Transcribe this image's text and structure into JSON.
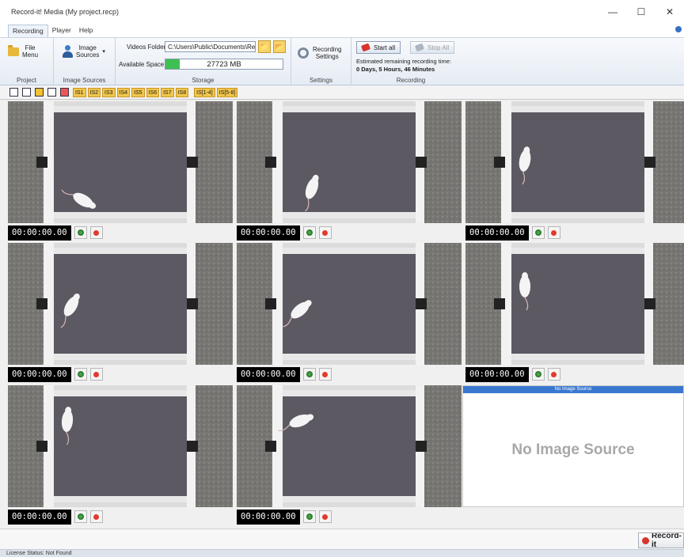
{
  "window": {
    "title": "Record-it! Media (My project.recp)",
    "controls": {
      "minimize": "—",
      "maximize": "☐",
      "close": "✕"
    }
  },
  "tabs": [
    {
      "label": "Recording",
      "active": true
    },
    {
      "label": "Player",
      "active": false
    },
    {
      "label": "Help",
      "active": false
    }
  ],
  "ribbon": {
    "project": {
      "group_label": "Project",
      "file_menu": "File\nMenu"
    },
    "image_sources": {
      "group_label": "Image Sources",
      "button": "Image\nSources"
    },
    "storage": {
      "group_label": "Storage",
      "videos_folder_label": "Videos Folder:",
      "videos_folder_value": "C:\\Users\\Public\\Documents\\Re",
      "available_space_label": "Available Space:",
      "available_space_value": "27723 MB",
      "available_space_fraction": 0.12
    },
    "settings": {
      "group_label": "Settings",
      "button": "Recording\nSettings"
    },
    "recording": {
      "group_label": "Recording",
      "start_all": "Start all",
      "stop_all": "Stop All",
      "remaining_label": "Estimated remaining recording time:",
      "remaining_value": "0 Days, 5 Hours, 46 Minutes"
    }
  },
  "view_toolbar": {
    "layout_icons": [
      "layout-1x1-icon",
      "layout-2x2-icon",
      "layout-3x3-icon",
      "layout-single-icon",
      "layout-pip-icon"
    ],
    "sources": [
      "IS1",
      "IS2",
      "IS3",
      "IS4",
      "IS5",
      "IS6",
      "IS7",
      "IS8"
    ],
    "groups": [
      "IS[1-4]",
      "IS[5-8]"
    ]
  },
  "cameras": [
    {
      "timer": "00:00:00.00"
    },
    {
      "timer": "00:00:00.00"
    },
    {
      "timer": "00:00:00.00"
    },
    {
      "timer": "00:00:00.00"
    },
    {
      "timer": "00:00:00.00"
    },
    {
      "timer": "00:00:00.00"
    },
    {
      "timer": "00:00:00.00"
    },
    {
      "timer": "00:00:00.00"
    }
  ],
  "no_source": {
    "header": "No Image Source",
    "text": "No Image Source"
  },
  "bottom": {
    "record_button": "Record-it"
  },
  "status": {
    "license": "License Status: Not Found"
  }
}
